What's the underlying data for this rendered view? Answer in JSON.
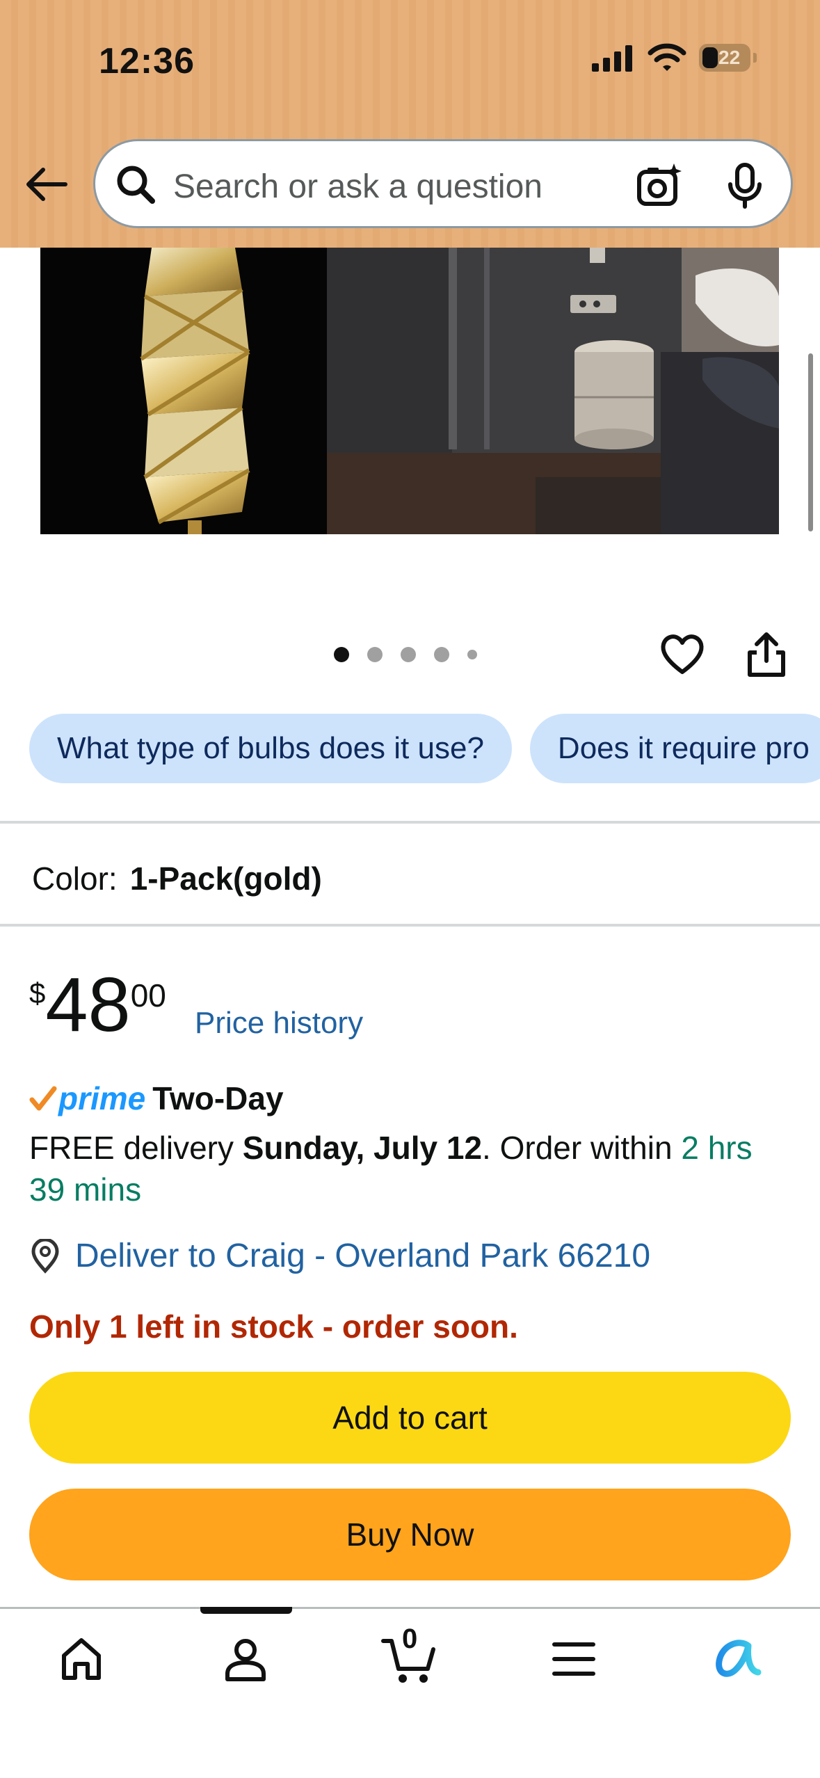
{
  "status_bar": {
    "time": "12:36",
    "battery": "22"
  },
  "search": {
    "placeholder": "Search or ask a question"
  },
  "product_gallery": {
    "dots_total": 5,
    "active_dot": 1
  },
  "questions": [
    {
      "label": "What type of bulbs does it use?"
    },
    {
      "label": "Does it require pro"
    }
  ],
  "color": {
    "label": "Color:",
    "value": "1-Pack(gold)"
  },
  "price": {
    "symbol": "$",
    "whole": "48",
    "fraction": "00",
    "history_link": "Price history"
  },
  "prime": {
    "word": "prime",
    "tail": "Two-Day"
  },
  "delivery": {
    "prefix": "FREE delivery ",
    "date": "Sunday, July 12",
    "middle": ". Order within ",
    "countdown": "2 hrs 39 mins"
  },
  "deliver_to": "Deliver to Craig - Overland Park 66210",
  "stock_warning": "Only 1 left in stock - order soon.",
  "buttons": {
    "add_to_cart": "Add to cart",
    "buy_now": "Buy Now"
  },
  "bottom_nav": {
    "cart_count": "0"
  },
  "colors": {
    "header": "#e7b07b",
    "add_to_cart": "#fcd814",
    "buy_now": "#ffa41c",
    "link": "#2162a1",
    "stock": "#b12704",
    "chip": "#cde3fc"
  }
}
